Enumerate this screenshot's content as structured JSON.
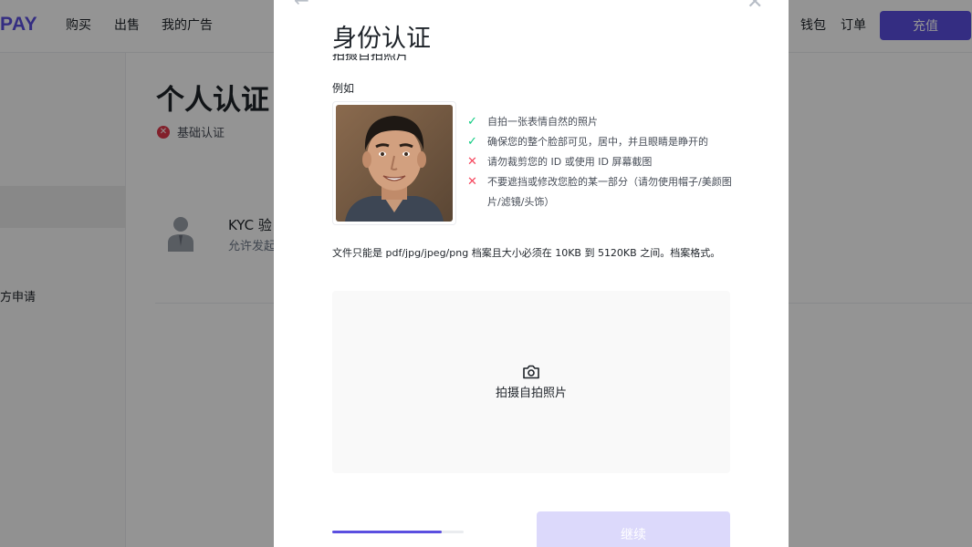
{
  "header": {
    "logo": "PAY",
    "nav": [
      "购买",
      "出售",
      "我的广告"
    ],
    "right_nav": [
      "钱包",
      "订单"
    ],
    "recharge_label": "充值"
  },
  "sidebar": {
    "item_text": "方申请"
  },
  "page": {
    "title": "个人认证",
    "basic_label": "基础认证",
    "kyc_title": "KYC 验",
    "kyc_sub": "允许发起"
  },
  "modal": {
    "title": "身份认证",
    "sub_heading": "拍摄自拍照片",
    "example_label": "例如",
    "rules": [
      {
        "type": "ok",
        "text": "自拍一张表情自然的照片"
      },
      {
        "type": "ok",
        "text": "确保您的整个脸部可见，居中，并且眼睛是睁开的"
      },
      {
        "type": "no",
        "text": "请勿裁剪您的 ID 或使用 ID 屏幕截图"
      },
      {
        "type": "no",
        "text": "不要遮挡或修改您脸的某一部分（请勿使用帽子/美颜图片/滤镜/头饰）"
      }
    ],
    "file_note": "文件只能是 pdf/jpg/jpeg/png 档案且大小必须在 10KB 到 5120KB 之间。档案格式。",
    "upload_label": "拍摄自拍照片",
    "progress": 0.83,
    "continue_label": "继续"
  },
  "icons": {
    "ok": "check-icon",
    "no": "cross-icon",
    "camera": "camera-icon",
    "back": "back-arrow-icon",
    "close": "close-icon"
  },
  "colors": {
    "brand": "#5b4fe0",
    "ok": "#0ecb81",
    "error": "#f6465d",
    "button_disabled": "#dcd9fb"
  }
}
